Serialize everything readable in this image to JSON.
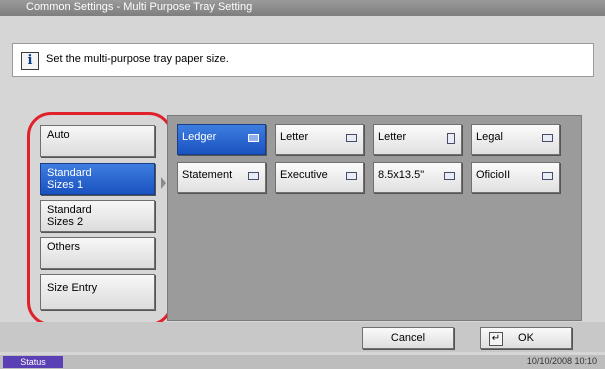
{
  "window": {
    "title": "Common Settings - Multi Purpose Tray Setting"
  },
  "info": {
    "icon_glyph": "i",
    "message": "Set the multi-purpose tray paper size."
  },
  "categories": [
    {
      "label": "Auto",
      "selected": false
    },
    {
      "label_line1": "Standard",
      "label_line2": "Sizes 1",
      "selected": true
    },
    {
      "label_line1": "Standard",
      "label_line2": "Sizes 2",
      "selected": false
    },
    {
      "label": "Others",
      "selected": false
    },
    {
      "label": "Size Entry",
      "selected": false
    }
  ],
  "paper_sizes": [
    {
      "label": "Ledger",
      "orientation": "landscape",
      "selected": true
    },
    {
      "label": "Letter",
      "orientation": "landscape",
      "selected": false
    },
    {
      "label": "Letter",
      "orientation": "portrait",
      "selected": false
    },
    {
      "label": "Legal",
      "orientation": "landscape",
      "selected": false
    },
    {
      "label": "Statement",
      "orientation": "landscape",
      "selected": false
    },
    {
      "label": "Executive",
      "orientation": "landscape",
      "selected": false
    },
    {
      "label": "8.5x13.5\"",
      "orientation": "landscape",
      "selected": false
    },
    {
      "label": "OficioII",
      "orientation": "landscape",
      "selected": false
    }
  ],
  "footer": {
    "cancel_label": "Cancel",
    "ok_label": "OK",
    "enter_icon_glyph": "↵"
  },
  "status_bar": {
    "status_label": "Status",
    "datetime": "10/10/2008   10:10"
  },
  "colors": {
    "selected_blue": "#1a52c0",
    "highlight_ring": "#e0202a",
    "status_tag": "#5a3fb5"
  }
}
